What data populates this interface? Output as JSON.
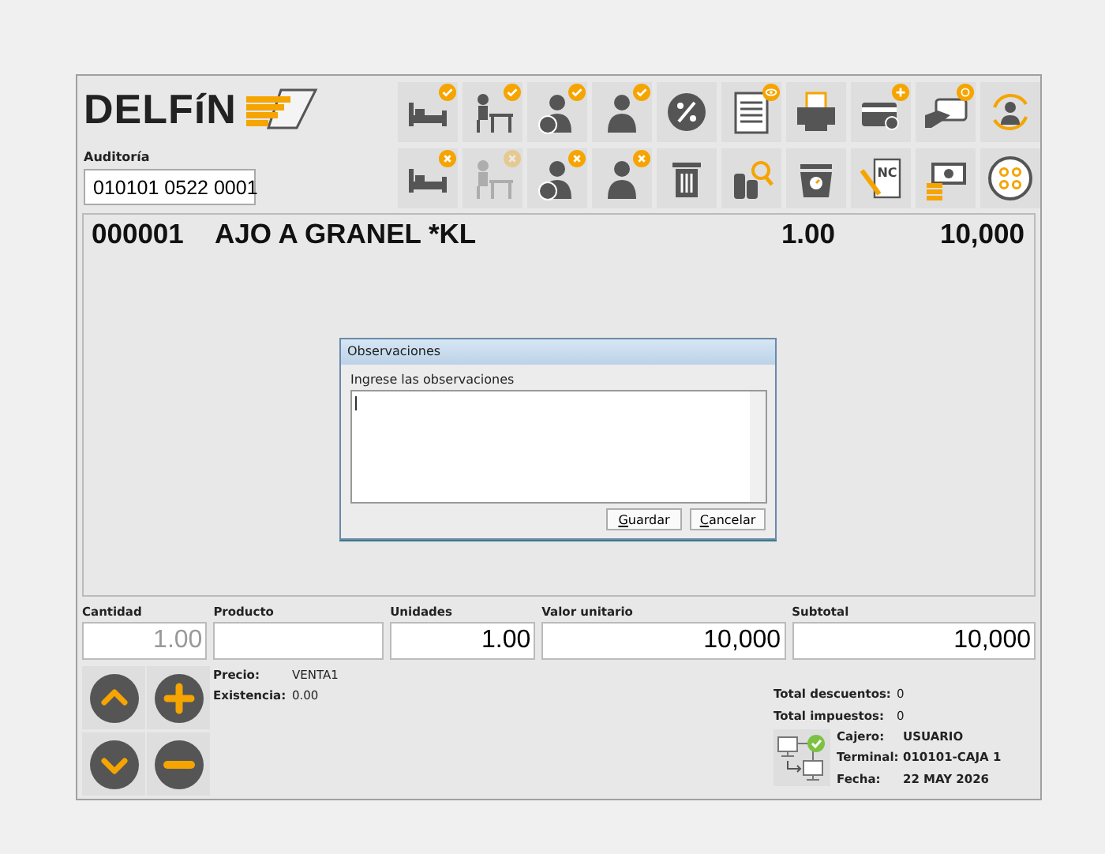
{
  "logo": {
    "text": "DELFíN"
  },
  "audit": {
    "label": "Auditoría",
    "value": "010101 0522 0001"
  },
  "toolbar_rows": [
    {
      "buttons": [
        {
          "kind": "bed",
          "badge": {
            "kind": "check"
          },
          "disabled": false
        },
        {
          "kind": "desk",
          "badge": {
            "kind": "check"
          },
          "disabled": false
        },
        {
          "kind": "person-coin",
          "badge": {
            "kind": "check"
          },
          "disabled": false
        },
        {
          "kind": "person",
          "badge": {
            "kind": "check"
          },
          "disabled": false
        },
        {
          "kind": "percent",
          "disabled": false
        },
        {
          "kind": "document",
          "badge": {
            "kind": "eye"
          },
          "disabled": false
        },
        {
          "kind": "printer",
          "disabled": false
        },
        {
          "kind": "card",
          "badge": {
            "kind": "plus"
          },
          "disabled": false
        },
        {
          "kind": "card-hand",
          "badge": {
            "kind": "coin"
          },
          "disabled": false
        },
        {
          "kind": "user-refresh",
          "disabled": false
        }
      ]
    },
    {
      "buttons": [
        {
          "kind": "bed",
          "badge": {
            "kind": "cross"
          },
          "disabled": false
        },
        {
          "kind": "desk",
          "badge": {
            "kind": "cross"
          },
          "disabled": true
        },
        {
          "kind": "person-coin",
          "badge": {
            "kind": "cross"
          },
          "disabled": false
        },
        {
          "kind": "person",
          "badge": {
            "kind": "cross"
          },
          "disabled": false
        },
        {
          "kind": "trash",
          "disabled": false
        },
        {
          "kind": "bottles-search",
          "disabled": false
        },
        {
          "kind": "scale",
          "disabled": false
        },
        {
          "kind": "credit-note",
          "text": "NC",
          "disabled": false
        },
        {
          "kind": "cash",
          "disabled": false
        },
        {
          "kind": "dots",
          "disabled": false
        }
      ]
    }
  ],
  "line_item": {
    "code": "000001",
    "description": "AJO A GRANEL *KL",
    "units": "1.00",
    "total": "10,000"
  },
  "dialog": {
    "title": "Observaciones",
    "prompt": "Ingrese las observaciones",
    "buttons": [
      {
        "label": "Guardar"
      },
      {
        "label": "Cancelar"
      }
    ]
  },
  "entry_fields": [
    {
      "label": "Cantidad",
      "placeholder": "1.00"
    },
    {
      "label": "Producto"
    },
    {
      "label": "Unidades",
      "value": "1.00"
    },
    {
      "label": "Valor unitario",
      "value": "10,000"
    },
    {
      "label": "Subtotal",
      "value": "10,000"
    }
  ],
  "nav_buttons": [
    {
      "kind": "up"
    },
    {
      "kind": "add"
    },
    {
      "kind": "down"
    },
    {
      "kind": "remove"
    }
  ],
  "product_info": [
    {
      "label": "Precio:",
      "value": "VENTA1"
    },
    {
      "label": "Existencia:",
      "value": "0.00"
    }
  ],
  "totals": [
    {
      "label": "Total descuentos:",
      "value": "0"
    },
    {
      "label": "Total impuestos:",
      "value": "0"
    }
  ],
  "session": {
    "connected": true,
    "fields": [
      {
        "label": "Cajero:",
        "value": "USUARIO"
      },
      {
        "label": "Terminal:",
        "value": "010101-CAJA 1"
      },
      {
        "label": "Fecha:",
        "value": "22 MAY 2026"
      }
    ]
  }
}
